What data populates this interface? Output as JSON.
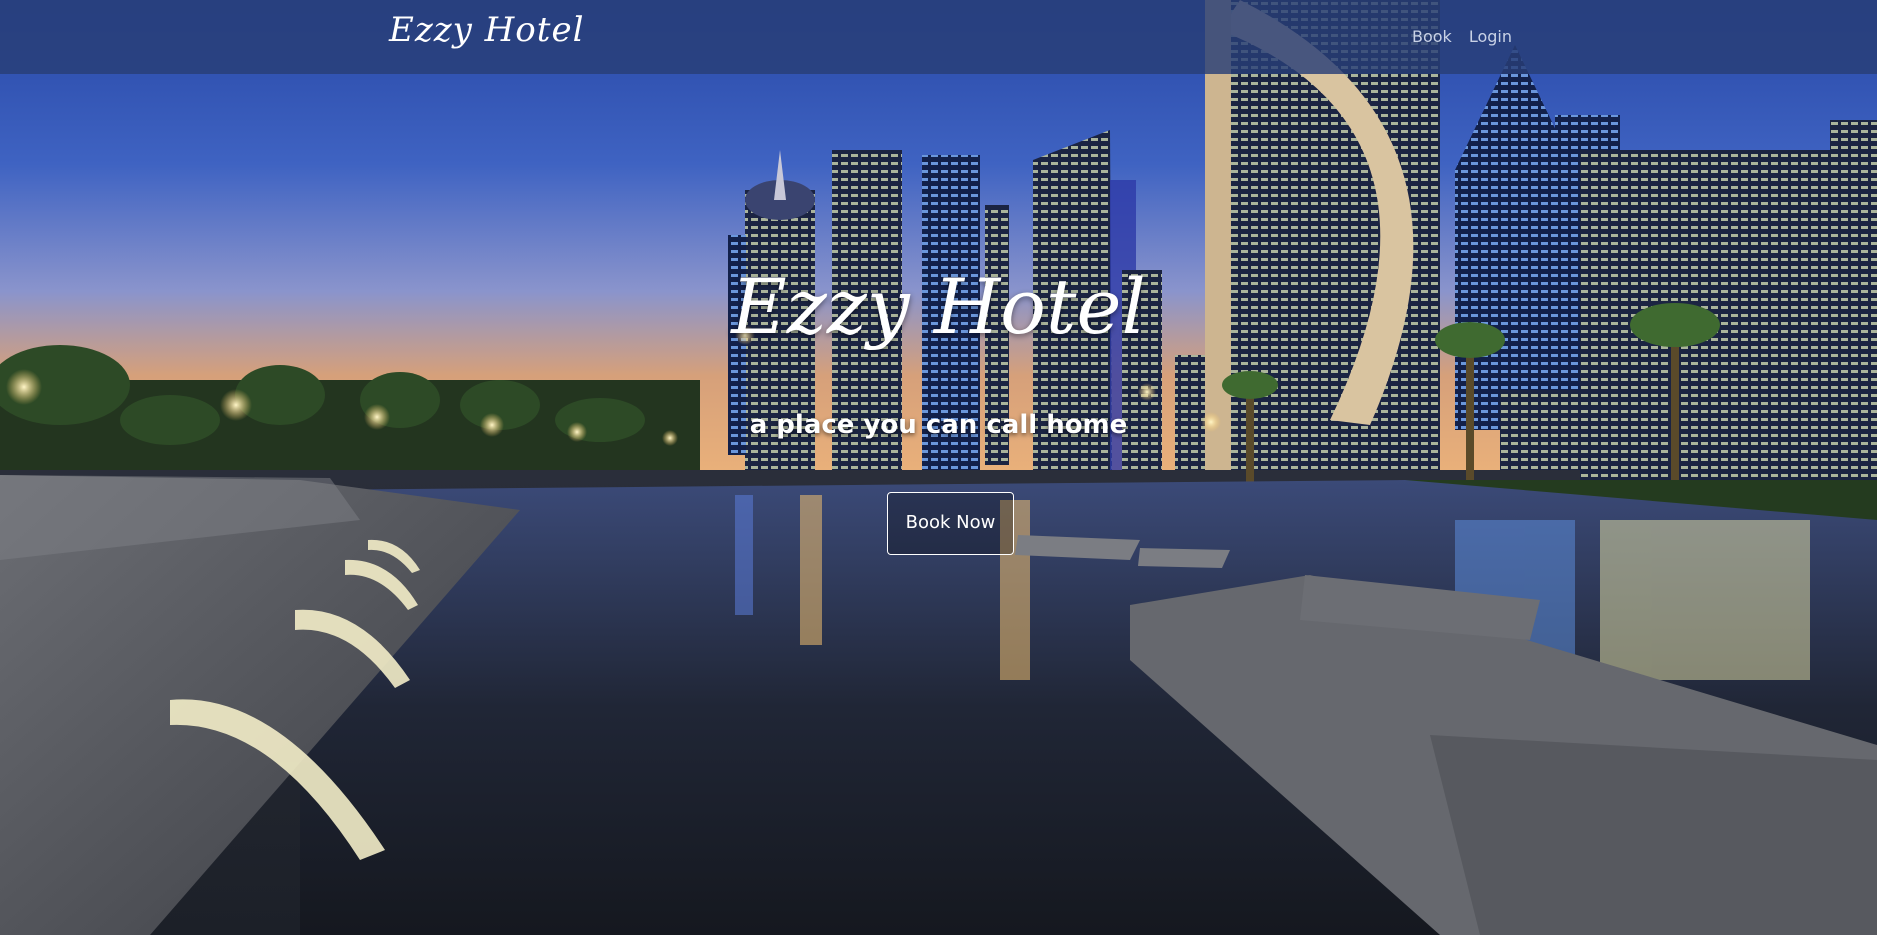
{
  "navbar": {
    "brand": "Ezzy Hotel",
    "links": [
      {
        "label": "Book"
      },
      {
        "label": "Login"
      }
    ]
  },
  "hero": {
    "title": "Ezzy Hotel",
    "subtitle": "a place you can call home",
    "cta_label": "Book Now"
  },
  "colors": {
    "navbar_bg": "#283e76",
    "text": "#ffffff",
    "nav_link": "#c9d2e6"
  }
}
